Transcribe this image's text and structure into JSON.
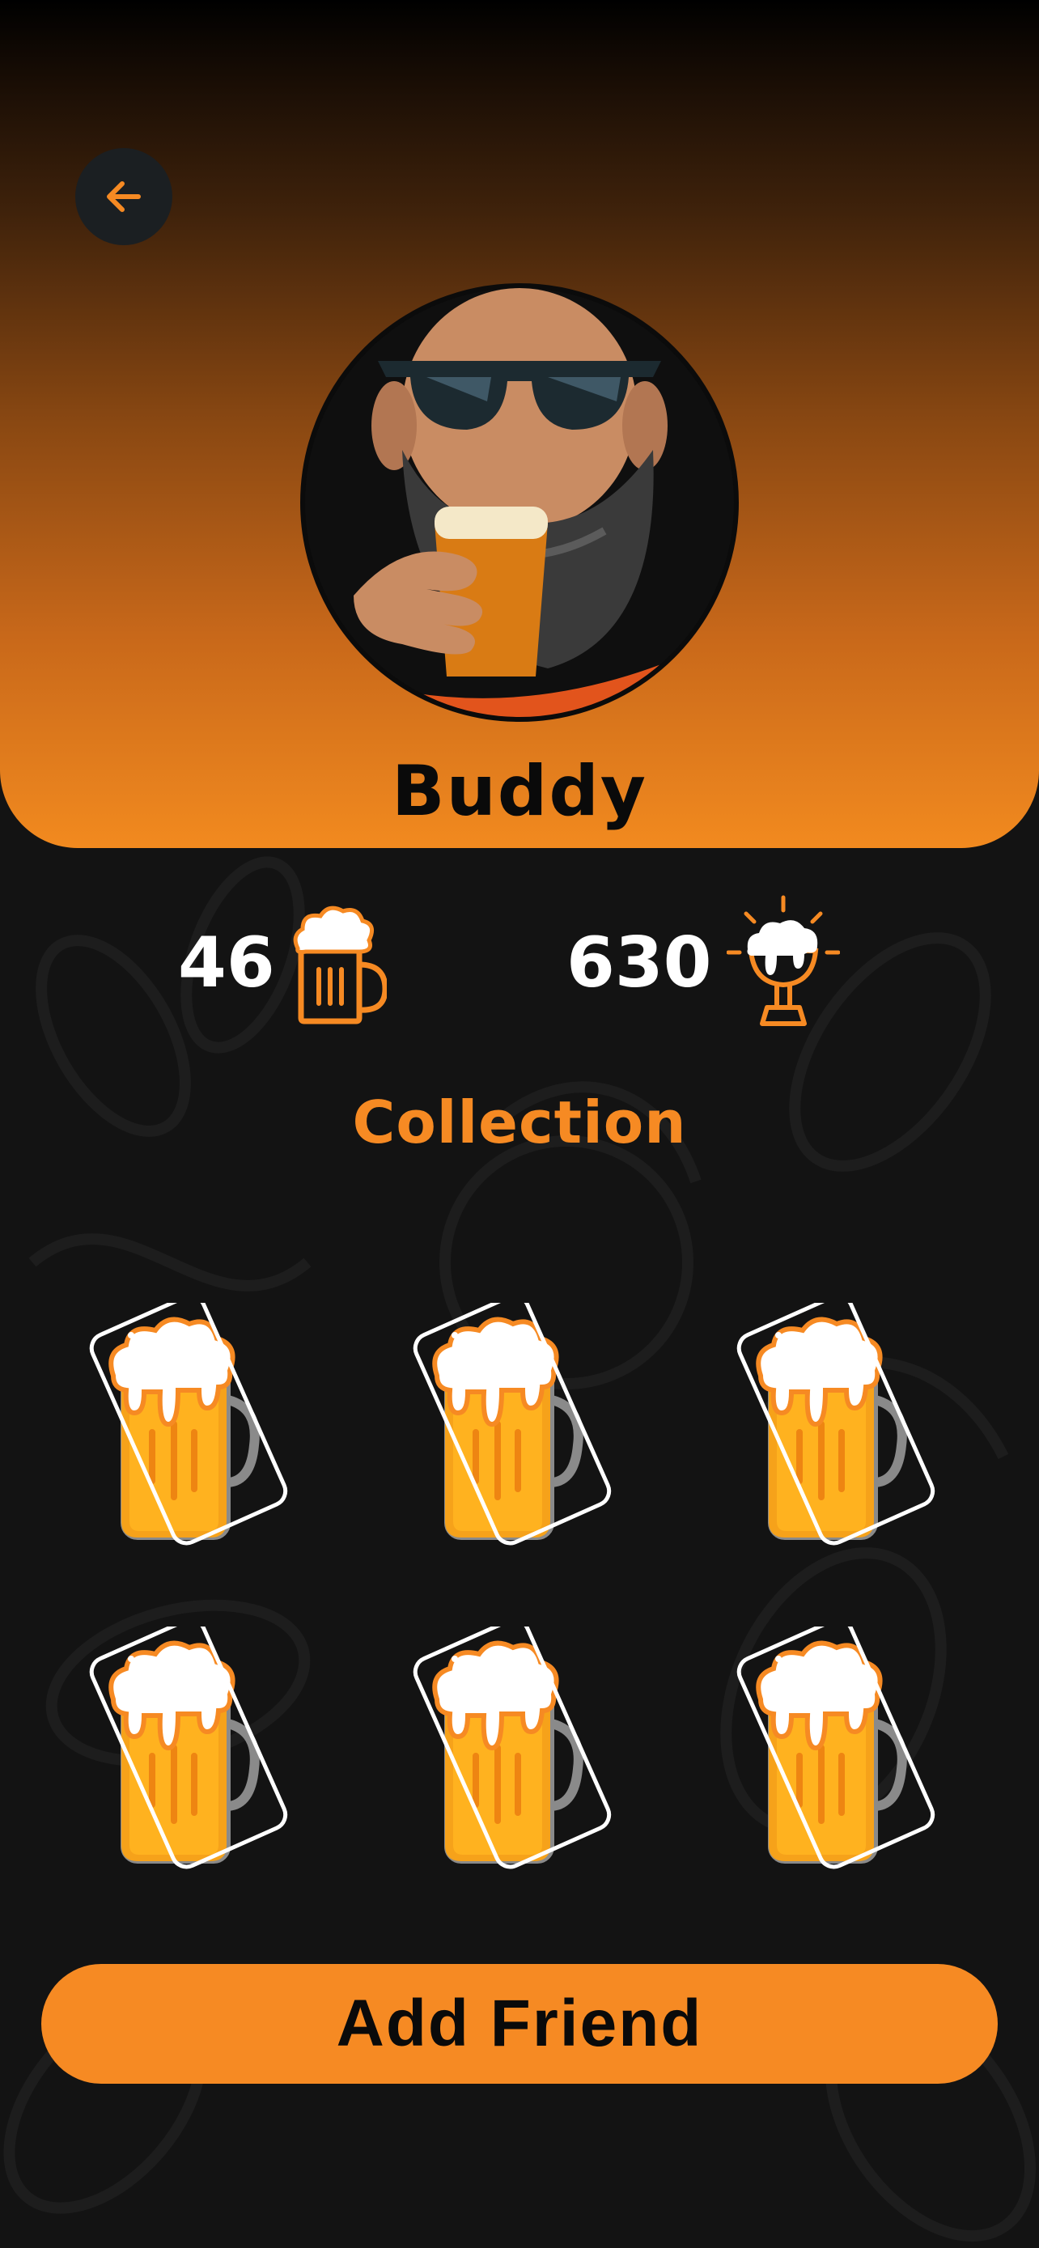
{
  "profile": {
    "name": "Buddy"
  },
  "stats": {
    "beers_count": "46",
    "points": "630"
  },
  "collection": {
    "title": "Collection",
    "items": [
      {
        "icon": "beer-card-icon"
      },
      {
        "icon": "beer-card-icon"
      },
      {
        "icon": "beer-card-icon"
      },
      {
        "icon": "beer-card-icon"
      },
      {
        "icon": "beer-card-icon"
      },
      {
        "icon": "beer-card-icon"
      }
    ]
  },
  "actions": {
    "add_friend_label": "Add Friend"
  },
  "colors": {
    "accent": "#f68a23",
    "background": "#131313",
    "back_button": "#1b1f22"
  }
}
